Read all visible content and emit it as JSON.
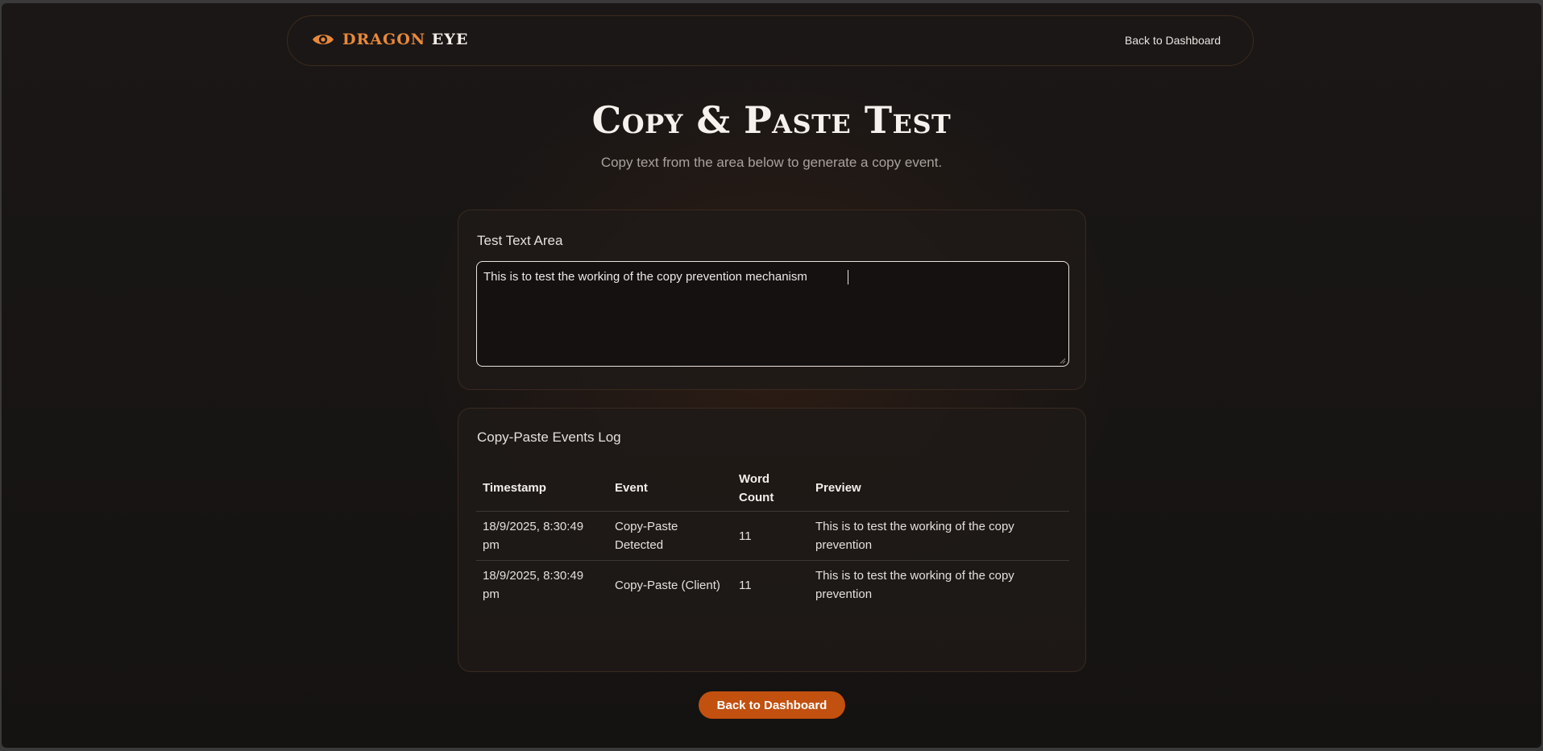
{
  "navbar": {
    "brand_part1": "DRAGON",
    "brand_part2": "EYE",
    "brand_icon": "eye-icon",
    "back_link": "Back to Dashboard"
  },
  "header": {
    "title": "Copy & Paste Test",
    "subtitle": "Copy text from the area below to generate a copy event."
  },
  "text_area_card": {
    "title": "Test Text Area",
    "value": "This is to test the working of the copy prevention mechanism"
  },
  "log_card": {
    "title": "Copy-Paste Events Log",
    "columns": [
      "Timestamp",
      "Event",
      "Word Count",
      "Preview"
    ],
    "rows": [
      {
        "timestamp": "18/9/2025, 8:30:49 pm",
        "event": "Copy-Paste Detected",
        "word_count": "11",
        "preview": "This is to test the working of the copy prevention"
      },
      {
        "timestamp": "18/9/2025, 8:30:49 pm",
        "event": "Copy-Paste (Client)",
        "word_count": "11",
        "preview": "This is to test the working of the copy prevention"
      }
    ]
  },
  "footer": {
    "back_button": "Back to Dashboard"
  },
  "colors": {
    "accent": "#e8893a",
    "button": "#c2500f",
    "background": "#161413"
  }
}
